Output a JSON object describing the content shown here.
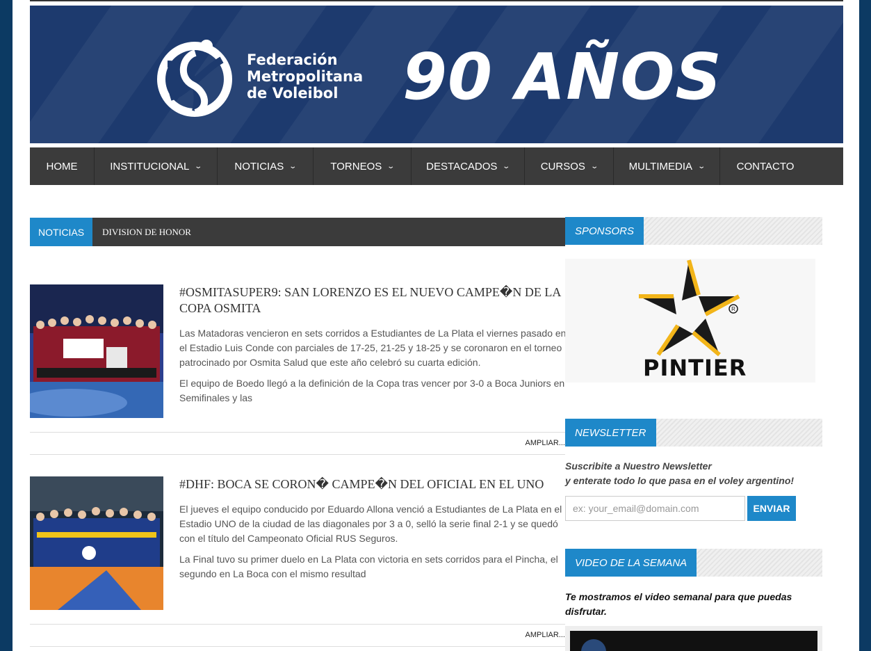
{
  "banner": {
    "org_line1": "Federación",
    "org_line2": "Metropolitana",
    "org_line3": "de Voleibol",
    "anniversary": "90 AÑOS"
  },
  "nav": [
    {
      "label": "HOME",
      "has_dropdown": false
    },
    {
      "label": "INSTITUCIONAL",
      "has_dropdown": true
    },
    {
      "label": "NOTICIAS",
      "has_dropdown": true
    },
    {
      "label": "TORNEOS",
      "has_dropdown": true
    },
    {
      "label": "DESTACADOS",
      "has_dropdown": true
    },
    {
      "label": "CURSOS",
      "has_dropdown": true
    },
    {
      "label": "MULTIMEDIA",
      "has_dropdown": true
    },
    {
      "label": "CONTACTO",
      "has_dropdown": false
    }
  ],
  "news_header": {
    "tag": "NOTICIAS",
    "ticker": "DIVISION DE HONOR"
  },
  "articles": [
    {
      "title": "#OSMITASUPER9: SAN LORENZO ES EL NUEVO CAMPE�N DE LA COPA OSMITA",
      "paragraph1": "Las Matadoras vencieron en sets corridos a Estudiantes de La Plata el viernes pasado en el Estadio Luis Conde con parciales de 17-25, 21-25 y 18-25 y se coronaron en el torneo patrocinado por Osmita Salud que este año celebró su cuarta edición.",
      "paragraph2": "El equipo de Boedo llegó a la definición de la Copa tras vencer por 3-0 a Boca Juniors en Semifinales y las",
      "more": "AMPLIAR..."
    },
    {
      "title": "#DHF: BOCA SE CORON� CAMPE�N DEL OFICIAL EN EL UNO",
      "paragraph1": "El jueves el equipo conducido por Eduardo Allona venció a Estudiantes de La Plata en el Estadio UNO de la ciudad de las diagonales por 3 a 0, selló la serie final 2-1 y se quedó con el título del Campeonato Oficial RUS Seguros.",
      "paragraph2": "La Final tuvo su primer duelo en La Plata con victoria en sets corridos para el Pincha, el segundo en La Boca con el mismo resultad",
      "more": "AMPLIAR..."
    }
  ],
  "sidebar": {
    "sponsors_label": "SPONSORS",
    "sponsor_name": "PINTIER",
    "newsletter_label": "NEWSLETTER",
    "newsletter_line1": "Suscribite a Nuestro Newsletter",
    "newsletter_line2": "y enterate todo lo que pasa en el voley argentino!",
    "email_placeholder": "ex: your_email@domain.com",
    "send_label": "ENVIAR",
    "video_label": "VIDEO DE LA SEMANA",
    "video_text": "Te mostramos el video semanal para que puedas disfrutar."
  },
  "colors": {
    "accent": "#1e88c9",
    "nav_bg": "#3b3b3b",
    "banner_bg": "#1d3a6e",
    "page_bg": "#0c3a63"
  }
}
